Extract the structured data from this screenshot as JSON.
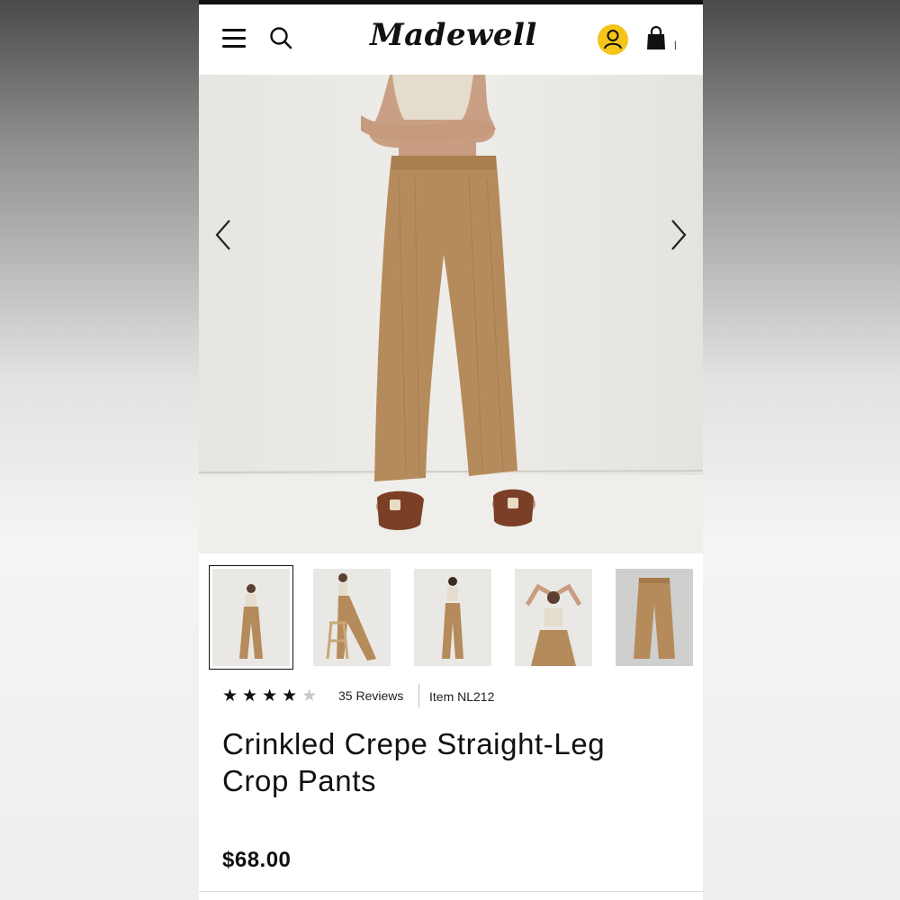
{
  "header": {
    "brand": "Madewell",
    "icons": [
      "menu-icon",
      "search-icon",
      "account-icon",
      "shopping-bag-icon"
    ],
    "bag_count": "|",
    "account_color": "#f5c518"
  },
  "gallery": {
    "main_image": "Model wearing tan crinkled crepe wide-leg crop pants with brown buckle sandals",
    "thumbnails": [
      {
        "name": "thumb-front",
        "selected": true
      },
      {
        "name": "thumb-side-stool",
        "selected": false
      },
      {
        "name": "thumb-back",
        "selected": false
      },
      {
        "name": "thumb-arms-raised",
        "selected": false
      },
      {
        "name": "thumb-flat-lay",
        "selected": false
      }
    ]
  },
  "product": {
    "rating": 4,
    "rating_max": 5,
    "reviews_label": "35 Reviews",
    "item_label": "Item NL212",
    "title_line1": "Crinkled Crepe Straight-Leg",
    "title_line2": "Crop Pants",
    "price": "$68.00",
    "pants_color": "#b58b5c"
  }
}
